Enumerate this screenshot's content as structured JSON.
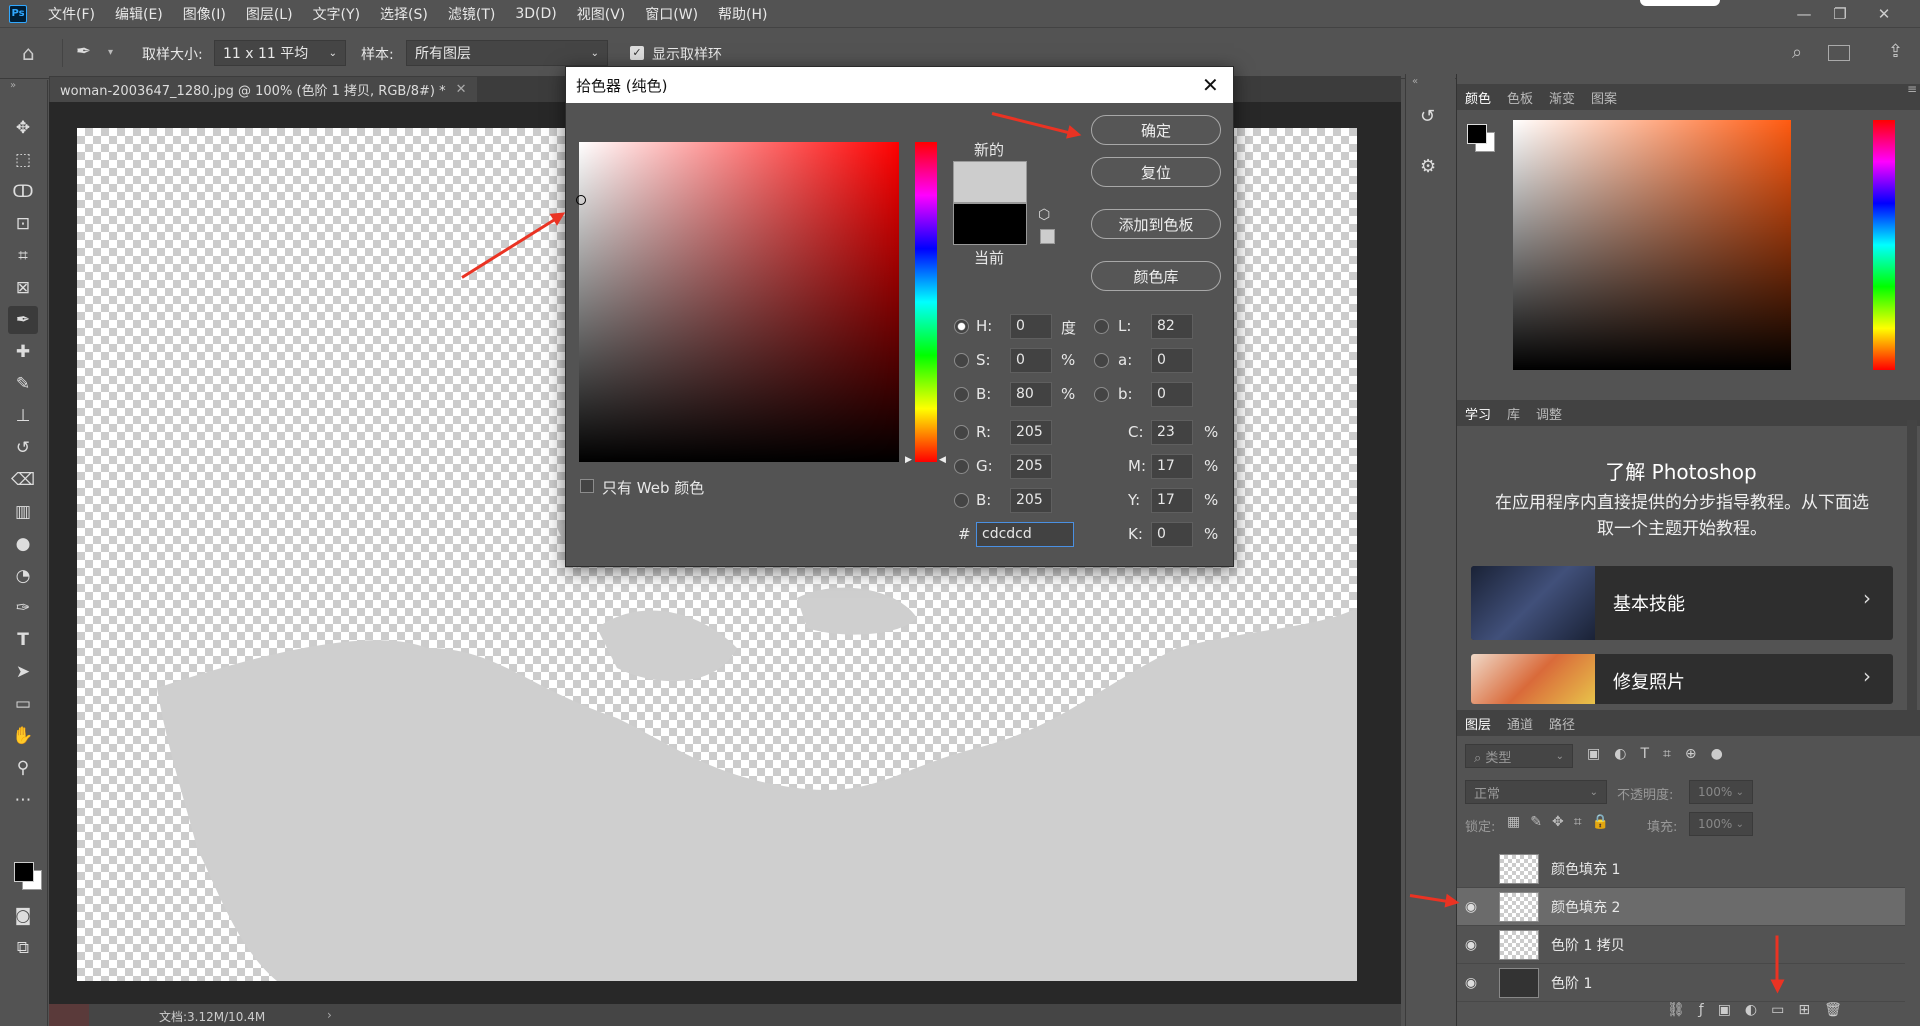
{
  "app": {
    "logo": "Ps"
  },
  "menu": [
    "文件(F)",
    "编辑(E)",
    "图像(I)",
    "图层(L)",
    "文字(Y)",
    "选择(S)",
    "滤镜(T)",
    "3D(D)",
    "视图(V)",
    "窗口(W)",
    "帮助(H)"
  ],
  "options": {
    "sample_size_label": "取样大小:",
    "sample_size_value": "11 x 11 平均",
    "sample_label": "样本:",
    "sample_value": "所有图层",
    "show_ring_label": "显示取样环"
  },
  "document": {
    "tab_title": "woman-2003647_1280.jpg @ 100% (色阶 1 拷贝, RGB/8#) *",
    "status": "文档:3.12M/10.4M"
  },
  "dialog": {
    "title": "拾色器 (纯色)",
    "ok": "确定",
    "reset": "复位",
    "add_to_swatches": "添加到色板",
    "color_libraries": "颜色库",
    "new_label": "新的",
    "current_label": "当前",
    "new_color": "#cdcdcd",
    "current_color": "#000000",
    "web_only_label": "只有 Web 颜色",
    "fields": {
      "H": {
        "label": "H:",
        "value": "0",
        "unit": "度"
      },
      "S": {
        "label": "S:",
        "value": "0",
        "unit": "%"
      },
      "Bv": {
        "label": "B:",
        "value": "80",
        "unit": "%"
      },
      "R": {
        "label": "R:",
        "value": "205"
      },
      "G": {
        "label": "G:",
        "value": "205"
      },
      "Bl": {
        "label": "B:",
        "value": "205"
      },
      "L": {
        "label": "L:",
        "value": "82"
      },
      "a": {
        "label": "a:",
        "value": "0"
      },
      "b": {
        "label": "b:",
        "value": "0"
      },
      "C": {
        "label": "C:",
        "value": "23",
        "unit": "%"
      },
      "M": {
        "label": "M:",
        "value": "17",
        "unit": "%"
      },
      "Y": {
        "label": "Y:",
        "value": "17",
        "unit": "%"
      },
      "K": {
        "label": "K:",
        "value": "0",
        "unit": "%"
      }
    },
    "hex_label": "#",
    "hex_value": "cdcdcd"
  },
  "color_panel": {
    "tabs": [
      "颜色",
      "色板",
      "渐变",
      "图案"
    ]
  },
  "learn_panel": {
    "tabs": [
      "学习",
      "库",
      "调整"
    ],
    "title": "了解 Photoshop",
    "desc": "在应用程序内直接提供的分步指导教程。从下面选取一个主题开始教程。",
    "cards": [
      "基本技能",
      "修复照片"
    ]
  },
  "layers_panel": {
    "tabs": [
      "图层",
      "通道",
      "路径"
    ],
    "search_placeholder": "类型",
    "blend_mode": "正常",
    "opacity_label": "不透明度:",
    "opacity_value": "100%",
    "lock_label": "锁定:",
    "fill_label": "填充:",
    "fill_value": "100%",
    "layers": [
      {
        "name": "颜色填充 1",
        "visible": false
      },
      {
        "name": "颜色填充 2",
        "visible": true
      },
      {
        "name": "色阶 1 拷贝",
        "visible": true
      },
      {
        "name": "色阶 1",
        "visible": true
      }
    ]
  },
  "colors": {
    "accent_red": "#ea3323",
    "panel_bg": "#535353"
  }
}
